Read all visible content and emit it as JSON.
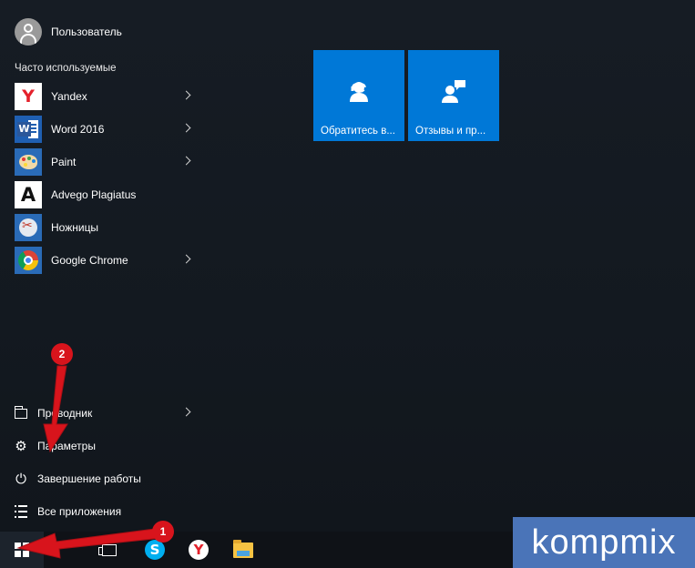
{
  "user": {
    "name": "Пользователь"
  },
  "section_title": "Часто используемые",
  "apps": [
    {
      "label": "Yandex",
      "icon": "yandex-icon",
      "has_submenu": true
    },
    {
      "label": "Word 2016",
      "icon": "word-icon",
      "has_submenu": true
    },
    {
      "label": "Paint",
      "icon": "paint-icon",
      "has_submenu": true
    },
    {
      "label": "Advego Plagiatus",
      "icon": "advego-icon",
      "has_submenu": false
    },
    {
      "label": "Ножницы",
      "icon": "scissors-icon",
      "has_submenu": false
    },
    {
      "label": "Google Chrome",
      "icon": "chrome-icon",
      "has_submenu": true
    }
  ],
  "bottom": {
    "explorer": "Проводник",
    "settings": "Параметры",
    "power": "Завершение работы",
    "all_apps": "Все приложения"
  },
  "tiles": [
    {
      "label": "Обратитесь в...",
      "icon": "contact-support-icon"
    },
    {
      "label": "Отзывы и пр...",
      "icon": "feedback-icon"
    }
  ],
  "annotations": {
    "step1": "1",
    "step2": "2"
  },
  "watermark": "kompmix",
  "colors": {
    "tile": "#0078d7",
    "arrow": "#d8141c",
    "watermark_bg": "#4a74b8"
  }
}
